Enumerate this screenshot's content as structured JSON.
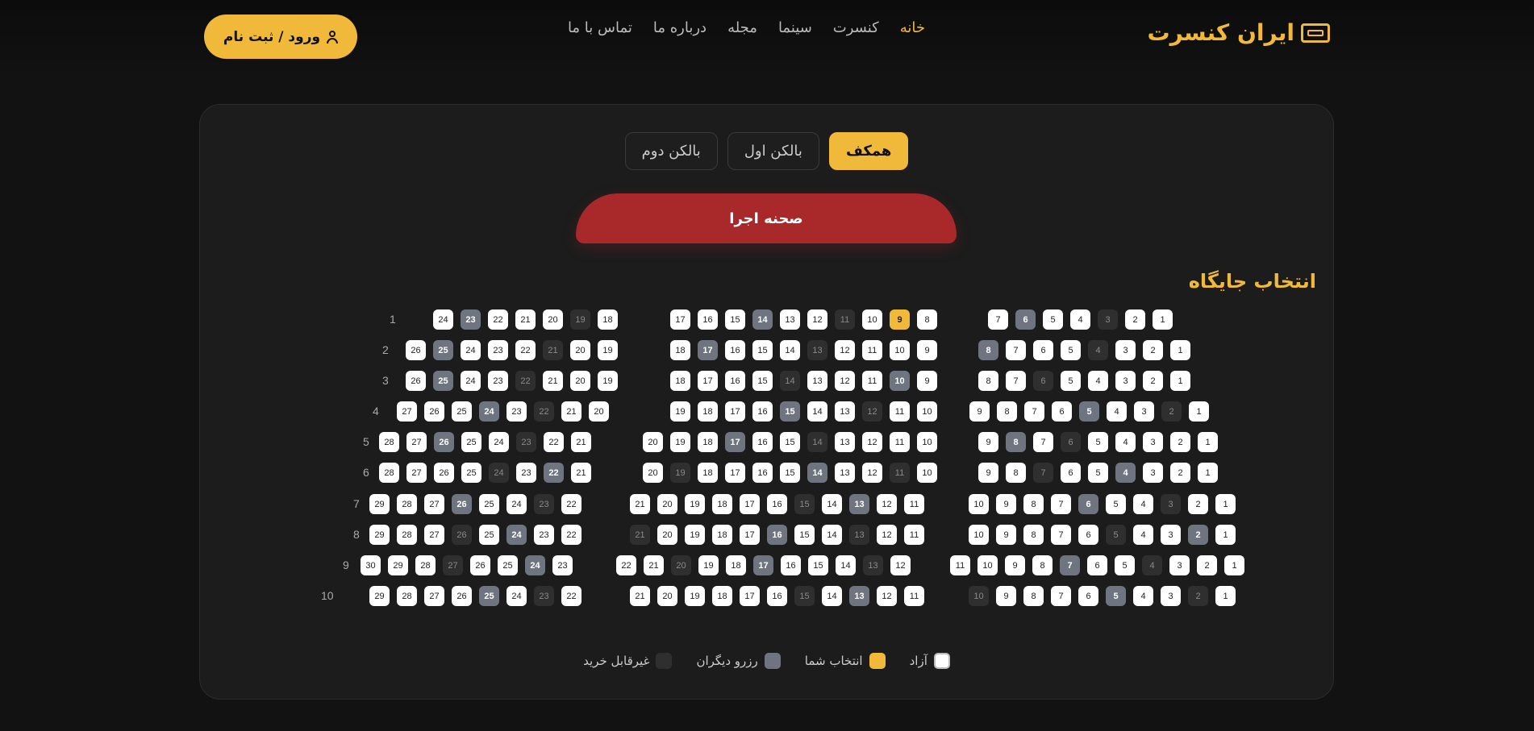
{
  "header": {
    "logo": "ایران کنسرت",
    "nav": [
      "خانه",
      "کنسرت",
      "سینما",
      "مجله",
      "درباره ما",
      "تماس با ما"
    ],
    "login": "ورود / ثبت نام"
  },
  "tabs": [
    "همکف",
    "بالکن اول",
    "بالکن دوم"
  ],
  "stage": "صحنه اجرا",
  "section_title": "انتخاب جایگاه",
  "row_labels": [
    "1",
    "2",
    "3",
    "4",
    "5",
    "6",
    "7",
    "8",
    "9",
    "10"
  ],
  "seat_sections": {
    "right": [
      {
        "seats": [
          1,
          2,
          3,
          4,
          5,
          6,
          7
        ],
        "reserved": [
          6
        ],
        "unavailable": [
          3
        ],
        "selected": []
      },
      {
        "seats": [
          1,
          2,
          3,
          4,
          5,
          6,
          7,
          8
        ],
        "reserved": [
          8
        ],
        "unavailable": [
          4
        ],
        "selected": []
      },
      {
        "seats": [
          1,
          2,
          3,
          4,
          5,
          6,
          7,
          8
        ],
        "reserved": [],
        "unavailable": [
          6
        ],
        "selected": []
      },
      {
        "seats": [
          1,
          2,
          3,
          4,
          5,
          6,
          7,
          8,
          9
        ],
        "reserved": [
          5
        ],
        "unavailable": [
          2
        ],
        "selected": []
      },
      {
        "seats": [
          1,
          2,
          3,
          4,
          5,
          6,
          7,
          8,
          9
        ],
        "reserved": [
          8
        ],
        "unavailable": [
          6
        ],
        "selected": []
      },
      {
        "seats": [
          1,
          2,
          3,
          4,
          5,
          6,
          7,
          8,
          9
        ],
        "reserved": [
          4
        ],
        "unavailable": [
          7
        ],
        "selected": []
      },
      {
        "seats": [
          1,
          2,
          3,
          4,
          5,
          6,
          7,
          8,
          9,
          10
        ],
        "reserved": [
          6
        ],
        "unavailable": [
          3
        ],
        "selected": []
      },
      {
        "seats": [
          1,
          2,
          3,
          4,
          5,
          6,
          7,
          8,
          9,
          10
        ],
        "reserved": [
          2
        ],
        "unavailable": [
          5
        ],
        "selected": []
      },
      {
        "seats": [
          1,
          2,
          3,
          4,
          5,
          6,
          7,
          8,
          9,
          10,
          11
        ],
        "reserved": [
          7
        ],
        "unavailable": [
          4
        ],
        "selected": []
      },
      {
        "seats": [
          1,
          2,
          3,
          4,
          5,
          6,
          7,
          8,
          9,
          10
        ],
        "reserved": [
          5
        ],
        "unavailable": [
          2,
          10
        ],
        "selected": []
      }
    ],
    "middle": [
      {
        "seats": [
          8,
          9,
          10,
          11,
          12,
          13,
          14,
          15,
          16,
          17
        ],
        "reserved": [
          14
        ],
        "unavailable": [
          11
        ],
        "selected": [
          9
        ]
      },
      {
        "seats": [
          9,
          10,
          11,
          12,
          13,
          14,
          15,
          16,
          17,
          18
        ],
        "reserved": [
          17
        ],
        "unavailable": [
          13
        ],
        "selected": []
      },
      {
        "seats": [
          9,
          10,
          11,
          12,
          13,
          14,
          15,
          16,
          17,
          18
        ],
        "reserved": [
          10
        ],
        "unavailable": [
          14
        ],
        "selected": []
      },
      {
        "seats": [
          10,
          11,
          12,
          13,
          14,
          15,
          16,
          17,
          18,
          19
        ],
        "reserved": [
          15
        ],
        "unavailable": [
          12
        ],
        "selected": []
      },
      {
        "seats": [
          10,
          11,
          12,
          13,
          14,
          15,
          16,
          17,
          18,
          19,
          20
        ],
        "reserved": [
          17
        ],
        "unavailable": [
          14
        ],
        "selected": []
      },
      {
        "seats": [
          10,
          11,
          12,
          13,
          14,
          15,
          16,
          17,
          18,
          19,
          20
        ],
        "reserved": [
          14
        ],
        "unavailable": [
          11,
          19
        ],
        "selected": []
      },
      {
        "seats": [
          11,
          12,
          13,
          14,
          15,
          16,
          17,
          18,
          19,
          20,
          21
        ],
        "reserved": [
          13
        ],
        "unavailable": [
          15
        ],
        "selected": []
      },
      {
        "seats": [
          11,
          12,
          13,
          14,
          15,
          16,
          17,
          18,
          19,
          20,
          21
        ],
        "reserved": [
          16
        ],
        "unavailable": [
          13,
          21
        ],
        "selected": []
      },
      {
        "seats": [
          12,
          13,
          14,
          15,
          16,
          17,
          18,
          19,
          20,
          21,
          22
        ],
        "reserved": [
          17
        ],
        "unavailable": [
          13,
          20
        ],
        "selected": []
      },
      {
        "seats": [
          11,
          12,
          13,
          14,
          15,
          16,
          17,
          18,
          19,
          20,
          21
        ],
        "reserved": [
          13
        ],
        "unavailable": [
          15
        ],
        "selected": []
      }
    ],
    "left": [
      {
        "seats": [
          18,
          19,
          20,
          21,
          22,
          23,
          24
        ],
        "reserved": [
          23
        ],
        "unavailable": [
          19
        ],
        "selected": []
      },
      {
        "seats": [
          19,
          20,
          21,
          22,
          23,
          24,
          25,
          26
        ],
        "reserved": [
          25
        ],
        "unavailable": [
          21
        ],
        "selected": []
      },
      {
        "seats": [
          19,
          20,
          21,
          22,
          23,
          24,
          25,
          26
        ],
        "reserved": [
          25
        ],
        "unavailable": [
          22
        ],
        "selected": []
      },
      {
        "seats": [
          20,
          21,
          22,
          23,
          24,
          25,
          26,
          27
        ],
        "reserved": [
          24
        ],
        "unavailable": [
          22
        ],
        "selected": []
      },
      {
        "seats": [
          21,
          22,
          23,
          24,
          25,
          26,
          27,
          28
        ],
        "reserved": [
          26
        ],
        "unavailable": [
          23
        ],
        "selected": []
      },
      {
        "seats": [
          21,
          22,
          23,
          24,
          25,
          26,
          27,
          28
        ],
        "reserved": [
          22
        ],
        "unavailable": [
          24
        ],
        "selected": []
      },
      {
        "seats": [
          22,
          23,
          24,
          25,
          26,
          27,
          28,
          29
        ],
        "reserved": [
          26
        ],
        "unavailable": [
          23
        ],
        "selected": []
      },
      {
        "seats": [
          22,
          23,
          24,
          25,
          26,
          27,
          28,
          29
        ],
        "reserved": [
          24
        ],
        "unavailable": [
          26
        ],
        "selected": []
      },
      {
        "seats": [
          23,
          24,
          25,
          26,
          27,
          28,
          29,
          30
        ],
        "reserved": [
          24
        ],
        "unavailable": [
          27
        ],
        "selected": []
      },
      {
        "seats": [
          22,
          23,
          24,
          25,
          26,
          27,
          28,
          29
        ],
        "reserved": [
          25
        ],
        "unavailable": [
          23
        ],
        "selected": []
      }
    ]
  },
  "legend": [
    {
      "label": "آزاد",
      "color": "#ffffff"
    },
    {
      "label": "انتخاب شما",
      "color": "#f0b93a"
    },
    {
      "label": "رزرو دیگران",
      "color": "#6e7480"
    },
    {
      "label": "غیرقابل خرید",
      "color": "#2f2f2f"
    }
  ]
}
